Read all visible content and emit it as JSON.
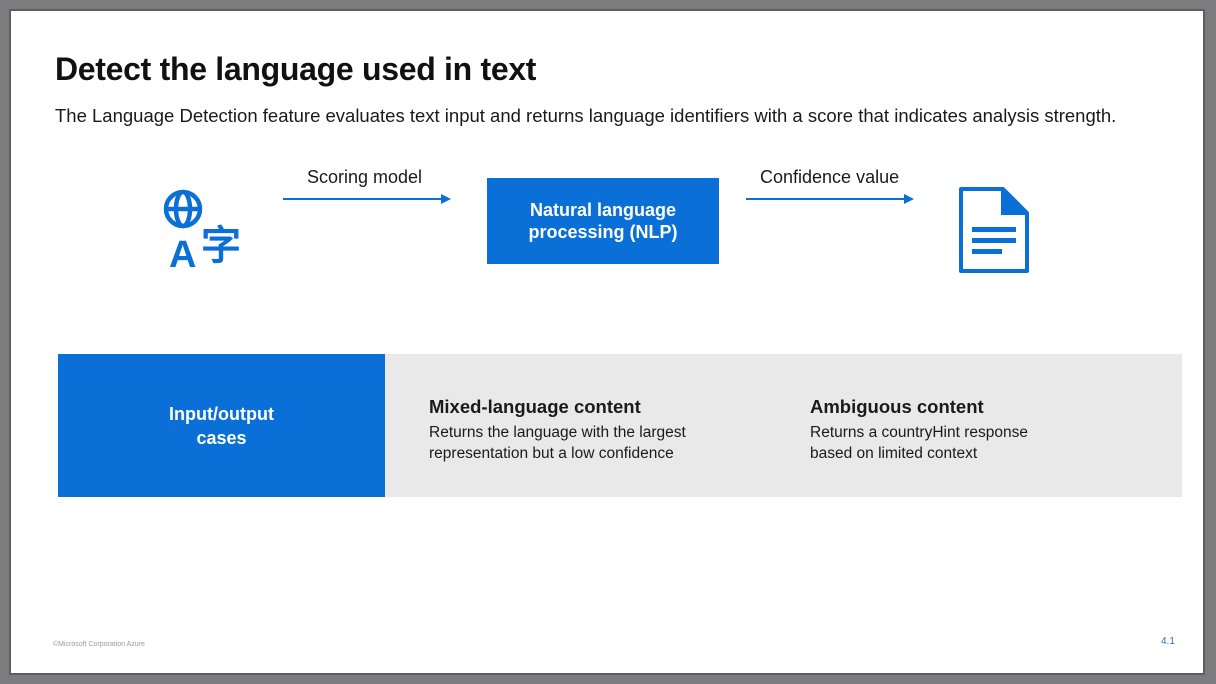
{
  "slide": {
    "title": "Detect the language used in text",
    "subtitle": "The Language Detection feature evaluates text input and returns language identifiers with a score that indicates analysis strength."
  },
  "flow": {
    "scoring_label": "Scoring model",
    "nlp_label": "Natural language processing (NLP)",
    "confidence_label": "Confidence value",
    "input_icon": "language-translate-icon",
    "output_icon": "document-icon",
    "accent_color": "#0a6fd6"
  },
  "cases": {
    "label": "Input/output cases",
    "items": [
      {
        "title": "Mixed-language content",
        "description": "Returns the language with the largest representation but a low confidence"
      },
      {
        "title": "Ambiguous content",
        "description": "Returns a countryHint response based on limited context"
      }
    ]
  },
  "footer": {
    "copyright": "©Microsoft Corporation Azure",
    "page_number": "4.1"
  }
}
